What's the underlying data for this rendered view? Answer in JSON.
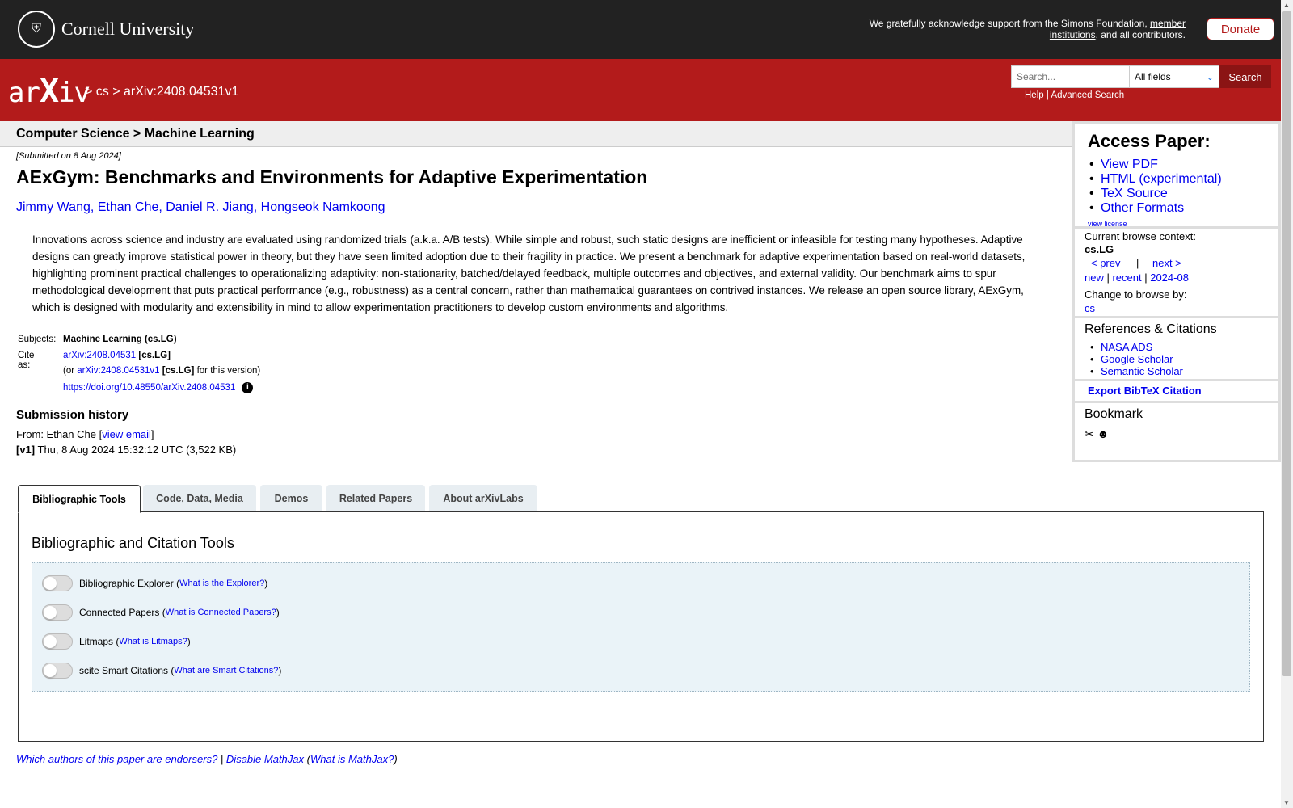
{
  "header": {
    "university": "Cornell University",
    "ack_prefix": "We gratefully acknowledge support from the Simons Foundation, ",
    "ack_link": "member institutions",
    "ack_suffix": ", and all contributors.",
    "donate": "Donate"
  },
  "nav": {
    "logo": "arXiv",
    "breadcrumb": "> cs > arXiv:2408.04531v1",
    "search_placeholder": "Search...",
    "search_field": "All fields",
    "search_button": "Search",
    "help": "Help",
    "separator": "|",
    "advanced": "Advanced Search"
  },
  "subject_bar": "Computer Science > Machine Learning",
  "paper": {
    "submitted": "[Submitted on 8 Aug 2024]",
    "title": "AExGym: Benchmarks and Environments for Adaptive Experimentation",
    "authors": [
      "Jimmy Wang",
      "Ethan Che",
      "Daniel R. Jiang",
      "Hongseok Namkoong"
    ],
    "abstract": "Innovations across science and industry are evaluated using randomized trials (a.k.a. A/B tests). While simple and robust, such static designs are inefficient or infeasible for testing many hypotheses. Adaptive designs can greatly improve statistical power in theory, but they have seen limited adoption due to their fragility in practice. We present a benchmark for adaptive experimentation based on real-world datasets, highlighting prominent practical challenges to operationalizing adaptivity: non-stationarity, batched/delayed feedback, multiple outcomes and objectives, and external validity. Our benchmark aims to spur methodological development that puts practical performance (e.g., robustness) as a central concern, rather than mathematical guarantees on contrived instances. We release an open source library, AExGym, which is designed with modularity and extensibility in mind to allow experimentation practitioners to develop custom environments and algorithms.",
    "subjects_label": "Subjects:",
    "subjects": "Machine Learning (cs.LG)",
    "cite_label": "Cite as:",
    "cite_id": "arXiv:2408.04531",
    "cite_cat": "[cs.LG]",
    "cite_or": "(or ",
    "cite_version_id": "arXiv:2408.04531v1",
    "cite_version_cat": "[cs.LG]",
    "cite_version_suffix": " for this version)",
    "doi": "https://doi.org/10.48550/arXiv.2408.04531",
    "submission_history_title": "Submission history",
    "from_prefix": "From: Ethan Che [",
    "view_email": "view email",
    "from_suffix": "]",
    "v1_label": "[v1]",
    "v1_text": " Thu, 8 Aug 2024 15:32:12 UTC (3,522 KB)"
  },
  "sidebar": {
    "access_title": "Access Paper:",
    "access_links": [
      "View PDF",
      "HTML (experimental)",
      "TeX Source",
      "Other Formats"
    ],
    "view_license": "view license",
    "browse_context_label": "Current browse context:",
    "browse_context": "cs.LG",
    "prev": "< prev",
    "bar": "|",
    "next": "next >",
    "new": "new",
    "recent": "recent",
    "month": "2024-08",
    "change_browse": "Change to browse by:",
    "browse_cs": "cs",
    "refs_title": "References & Citations",
    "refs": [
      "NASA ADS",
      "Google Scholar",
      "Semantic Scholar"
    ],
    "export": "Export BibTeX Citation",
    "bookmark_title": "Bookmark"
  },
  "tabs": [
    "Bibliographic Tools",
    "Code, Data, Media",
    "Demos",
    "Related Papers",
    "About arXivLabs"
  ],
  "panel": {
    "title": "Bibliographic and Citation Tools",
    "tools": [
      {
        "label": "Bibliographic Explorer",
        "link": "What is the Explorer?"
      },
      {
        "label": "Connected Papers",
        "link": "What is Connected Papers?"
      },
      {
        "label": "Litmaps",
        "link": "What is Litmaps?"
      },
      {
        "label": "scite Smart Citations",
        "link": "What are Smart Citations?"
      }
    ]
  },
  "footer": {
    "endorsers": "Which authors of this paper are endorsers?",
    "sep": " | ",
    "disable_mathjax": "Disable MathJax",
    "what_mathjax": "What is MathJax?"
  },
  "colors": {
    "brand_red": "#b31b1b",
    "link": "#0000ee",
    "top_bar": "#222222"
  }
}
